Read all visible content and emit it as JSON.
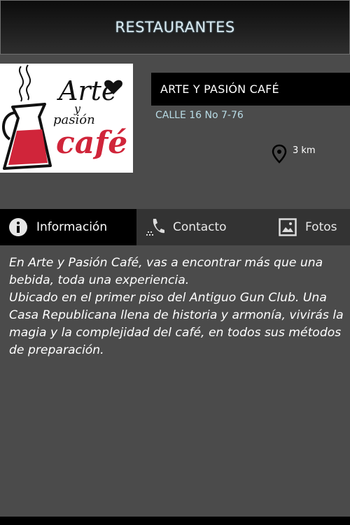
{
  "header": {
    "title": "RESTAURANTES"
  },
  "restaurant": {
    "name": "ARTE Y PASIÓN CAFÉ",
    "address": "CALLE 16 No 7-76",
    "distance": "3 km",
    "logo": {
      "line1": "Arte",
      "line2": "y",
      "line3": "pasión",
      "line4": "café"
    }
  },
  "tabs": [
    {
      "label": "Información",
      "icon": "info-icon",
      "active": true
    },
    {
      "label": "Contacto",
      "icon": "phone-icon",
      "active": false
    },
    {
      "label": "Fotos",
      "icon": "image-icon",
      "active": false
    }
  ],
  "description": {
    "paragraph1": "En Arte y Pasión Café, vas a encontrar más que una bebida, toda una experiencia.",
    "paragraph2": "Ubicado en el primer piso del Antiguo Gun Club. Una Casa Republicana llena de historia y armonía, vivirás la magia y la complejidad del café, en todos sus métodos de preparación."
  },
  "colors": {
    "background": "#4b4b4b",
    "header_text": "#d9eaf0",
    "address_text": "#b9dce6",
    "logo_red": "#d0253a",
    "active_tab": "#000000"
  }
}
